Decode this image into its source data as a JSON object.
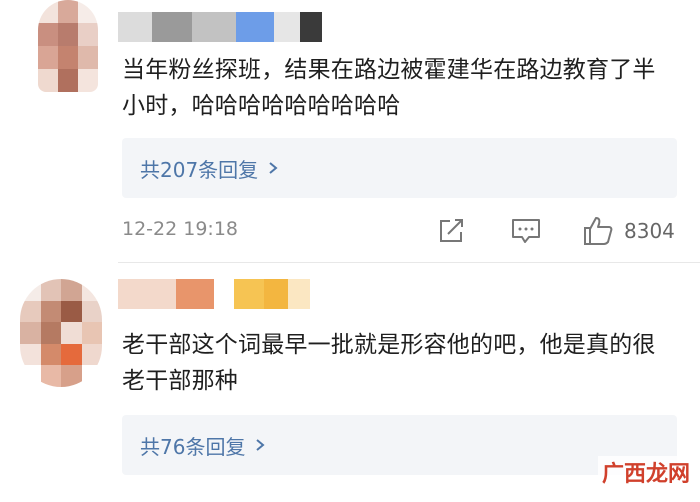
{
  "comments": [
    {
      "text": "当年粉丝探班，结果在路边被霍建华在路边教育了半小时，哈哈哈哈哈哈哈哈哈",
      "replies_label": "共207条回复",
      "timestamp": "12-22 19:18",
      "like_count": "8304"
    },
    {
      "text": "老干部这个词最早一批就是形容他的吧，他是真的很老干部那种",
      "replies_label": "共76条回复",
      "timestamp": "",
      "like_count": ""
    }
  ],
  "watermark": "广西龙网",
  "icons": {
    "share": "share-icon",
    "reply": "comment-icon",
    "like": "thumbs-up-icon",
    "chevron": "chevron-right-icon"
  },
  "colors": {
    "link": "#4e76a8",
    "reply_box_bg": "#f3f5f8",
    "muted": "#8a8a8a",
    "watermark": "#d0402c"
  }
}
